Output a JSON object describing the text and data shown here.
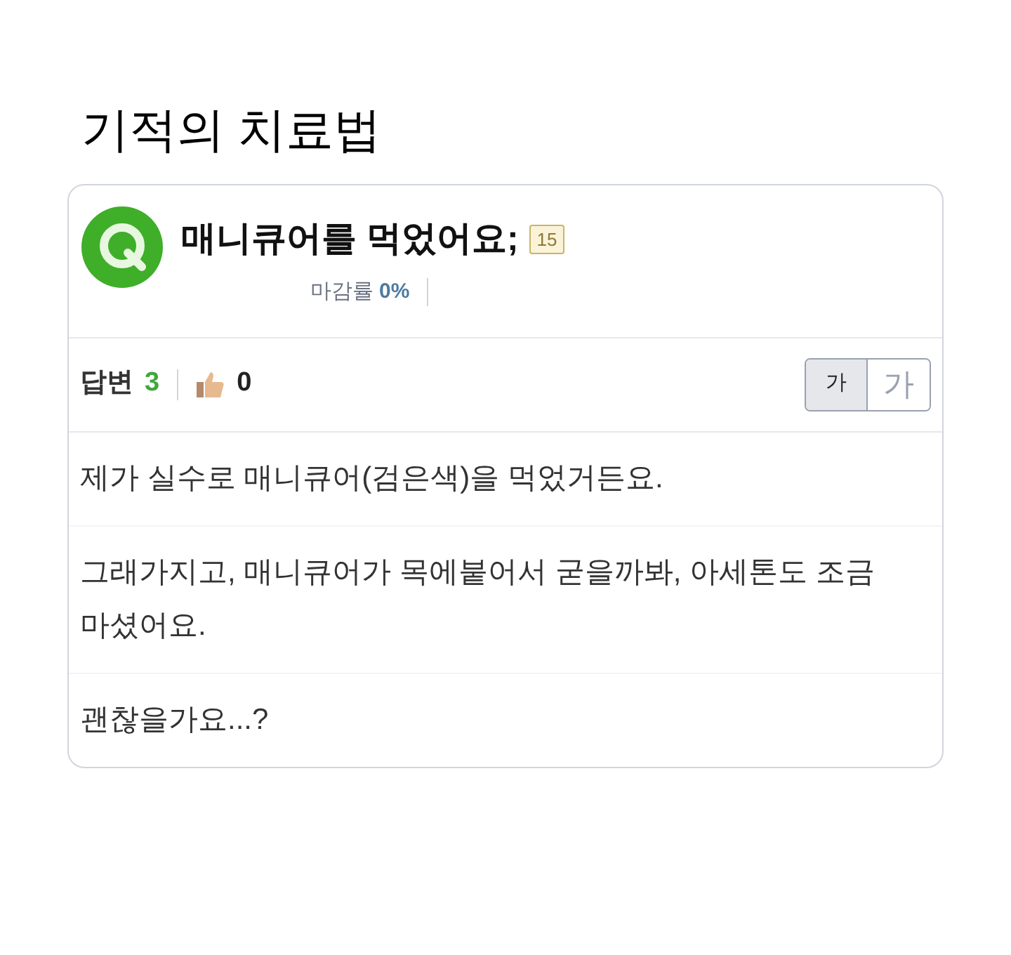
{
  "page_title": "기적의 치료법",
  "question": {
    "title": "매니큐어를 먹었어요;",
    "points": "15",
    "close_rate_label": "마감률",
    "close_rate": "0%"
  },
  "stats": {
    "answers_label": "답변",
    "answers": "3",
    "likes": "0"
  },
  "font_sizes": [
    {
      "label": "가",
      "selected": true
    },
    {
      "label": "가",
      "selected": false
    }
  ],
  "paragraphs": [
    "제가 실수로 매니큐어(검은색)을 먹었거든요.",
    "그래가지고, 매니큐어가 목에붙어서 굳을까봐, 아세톤도 조금 마셨어요.",
    "괜찮을가요...?"
  ]
}
